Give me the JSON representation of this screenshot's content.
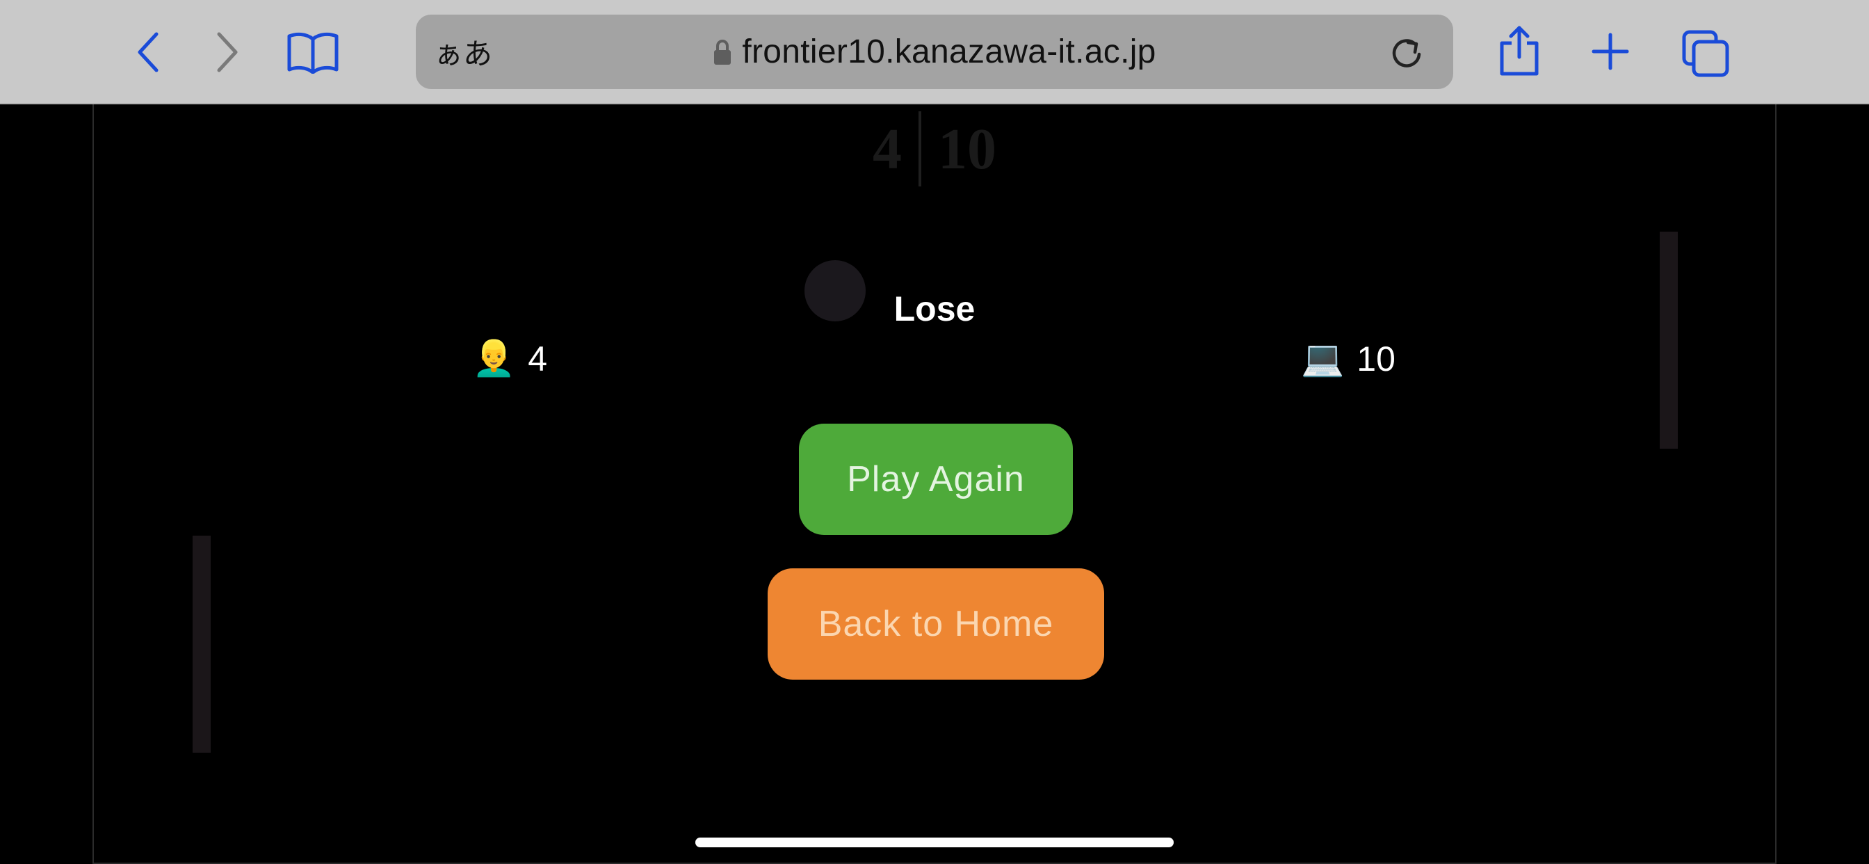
{
  "browser": {
    "reader_label": "ぁあ",
    "url": "frontier10.kanazawa-it.ac.jp",
    "accent_color": "#1a4bd8"
  },
  "game": {
    "background_score": {
      "left": "4",
      "right": "10"
    },
    "result": "Lose",
    "player": {
      "icon": "🧑‍🦲",
      "emoji": "👱‍♂️",
      "score": "4"
    },
    "computer": {
      "emoji": "💻",
      "score": "10"
    },
    "play_again_label": "Play Again",
    "back_home_label": "Back to Home",
    "colors": {
      "play_again": "#4eaa3a",
      "back_home": "#ee8632"
    }
  }
}
